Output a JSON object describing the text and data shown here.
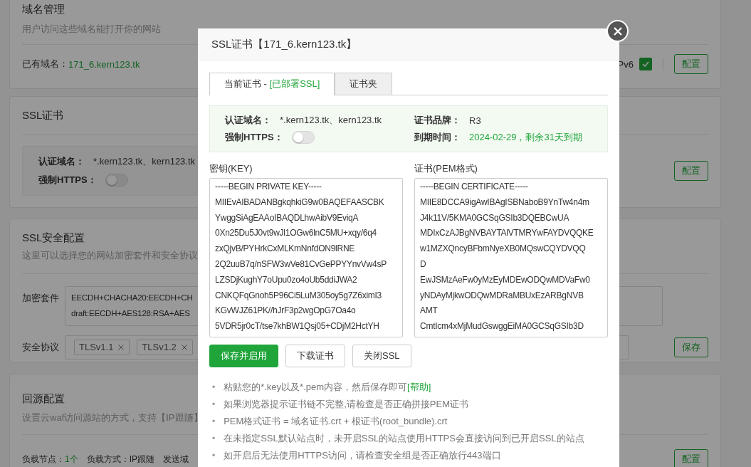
{
  "page": {
    "sections": [
      {
        "kind": "domains",
        "title": "域名管理",
        "subtitle": "用户访问这些域名能打开你的网站",
        "label": "已有域名：",
        "domain": "171_6.kern123.tk",
        "ipv6_label": "Pv6",
        "ipv6_checked": true,
        "button": "配置"
      },
      {
        "kind": "ssl",
        "title": "SSL证书",
        "domain_label": "认证域名：",
        "domains": "*.kern123.tk、kern123.tk",
        "https_label": "强制HTTPS：",
        "https_on": false,
        "button": "配置"
      },
      {
        "kind": "security",
        "title": "SSL安全配置",
        "subtitle": "这里可以选择您的网站加密套件和安全协议",
        "cipher_label": "加密套件",
        "cipher_lines": [
          "EECDH+CHACHA20:EECDH+CH",
          "draft:EECDH+AES128:RSA+AES"
        ],
        "protocol_label": "安全协议",
        "protocols": [
          "TLSv1.1",
          "TLSv1.2"
        ],
        "button": "保存"
      },
      {
        "kind": "origin",
        "title": "回源配置",
        "subtitle": "设置云waf访问源站的方式，支持【IP跟随】",
        "node_label": "负载节点：",
        "node_value": "1个",
        "mode_label": "负载方式：",
        "mode_value": "IP跟随",
        "host_label": "发送域",
        "button": "配置"
      }
    ]
  },
  "dialog": {
    "title": "SSL证书【171_6.kern123.tk】",
    "tabs": [
      {
        "label": "当前证书 - ",
        "status": "[已部署SSL]",
        "selected": true
      },
      {
        "label": "证书夹",
        "selected": false
      }
    ],
    "info": {
      "domain_label": "认证域名：",
      "domains": "*.kern123.tk、kern123.tk",
      "https_label": "强制HTTPS：",
      "https_on": false,
      "brand_label": "证书品牌：",
      "brand": "R3",
      "expiry_label": "到期时间：",
      "expiry": "2024-02-29，剩余31天到期"
    },
    "key": {
      "label": "密钥(KEY)",
      "lines": [
        "-----BEGIN PRIVATE KEY-----",
        "MIIEvAIBADANBgkqhkiG9w0BAQEFAASCBK",
        "YwggSiAgEAAoIBAQDLhwAibV9EviqA",
        "0Xn25Du5J0vt9wJl1OGw6lnC5MU+xqy/6q4",
        "zxQjvB/PYHrkCxMLKmNnfdON9lRNE",
        "2Q2uuB7q/nSFW3wVe81CvGePPYYnvVw4sP",
        "LZSDjKughY7oUpu0zo4oUb5ddiJWA2",
        "CNKQFqGnoh5P96Ci5LuM305oy5g7Z6ximI3",
        "KGvWJZ61PK//hJrF3p2wgOpG7Oa4o",
        "5VDR5jr0cT/tse7khBW1Qsj05+CDjM2HctYH"
      ]
    },
    "cert": {
      "label": "证书(PEM格式)",
      "lines": [
        "-----BEGIN CERTIFICATE-----",
        "MIIE8DCCA9igAwIBAgISBNaboB9YnTw4n4m",
        "J4k11V/5KMA0GCSqGSIb3DQEBCwUA",
        "MDIxCzAJBgNVBAYTAlVTMRYwFAYDVQQKE",
        "w1MZXQncyBFbmNyeXB0MQswCQYDVQQ",
        "D",
        "EwJSMzAeFw0yMzEyMDEwODQwMDVaFw0",
        "yNDAyMjkwODQwMDRaMBUxEzARBgNVB",
        "AMT",
        "CmtIcm4xMjMudGswggEiMA0GCSqGSIb3D"
      ]
    },
    "buttons": [
      {
        "label": "保存并启用",
        "primary": true
      },
      {
        "label": "下载证书",
        "primary": false
      },
      {
        "label": "关闭SSL",
        "primary": false
      }
    ],
    "notes": [
      {
        "marker": "•",
        "text": "粘贴您的*.key以及*.pem内容，然后保存即可",
        "link": "[帮助]"
      },
      {
        "marker": "•",
        "text": "如果浏览器提示证书链不完整,请检查是否正确拼接PEM证书"
      },
      {
        "marker": "•",
        "text": "PEM格式证书 = 域名证书.crt + 根证书(root_bundle).crt"
      },
      {
        "marker": "•",
        "text": "在未指定SSL默认站点时，未开启SSL的站点使用HTTPS会直接访问到已开启SSL的站点"
      },
      {
        "marker": "•",
        "text": "如开启后无法使用HTTPS访问，请检查安全组是否正确放行443端口"
      }
    ]
  }
}
